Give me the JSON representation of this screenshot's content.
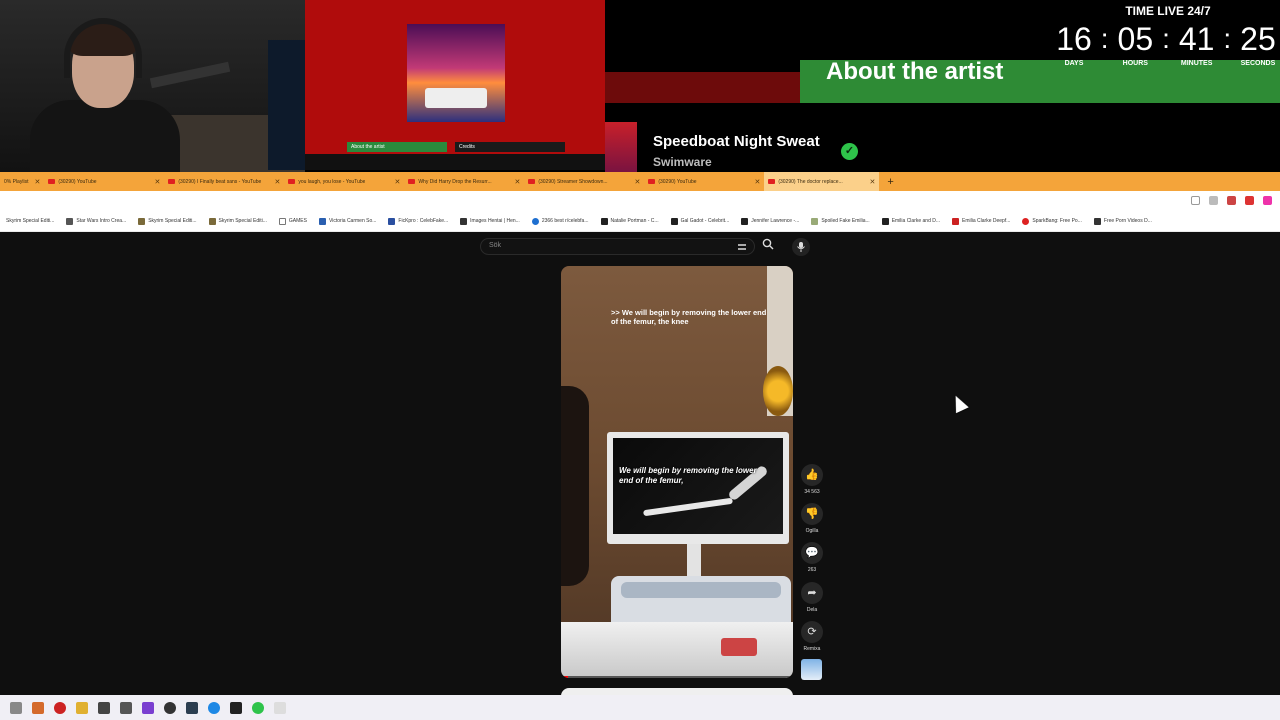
{
  "stream_overlay": {
    "time_live_label": "TIME LIVE 24/7",
    "timer": [
      {
        "value": "16",
        "caption": "DAYS"
      },
      {
        "value": "05",
        "caption": "HOURS"
      },
      {
        "value": "41",
        "caption": "MINUTES"
      },
      {
        "value": "25",
        "caption": "SECONDS"
      }
    ],
    "about_the_artist": "About the artist",
    "now_playing": {
      "title": "Speedboat Night Sweat",
      "artist": "Swimware"
    },
    "inner_screen": {
      "about_button": "About the artist",
      "credits_button": "Credits"
    }
  },
  "browser": {
    "tabs": [
      {
        "label": "0% Playlist",
        "icon": "youtube-icon"
      },
      {
        "label": "(30290) YouTube",
        "icon": "youtube-icon"
      },
      {
        "label": "(30290) I Finally beat sans - YouTube",
        "icon": "youtube-icon"
      },
      {
        "label": "you laugh, you lose - YouTube",
        "icon": "youtube-icon"
      },
      {
        "label": "Why Did Harry Drop the Resurr...",
        "icon": "youtube-icon"
      },
      {
        "label": "(30290) Streamer Showdown...",
        "icon": "youtube-icon"
      },
      {
        "label": "(30290) YouTube",
        "icon": "youtube-icon"
      },
      {
        "label": "(30290) The doctor replace...",
        "icon": "youtube-icon"
      }
    ],
    "bookmarks": [
      "Skyrim Special Editi...",
      "Star Wars Intro Crea...",
      "Skyrim Special Editi...",
      "Skyrim Special Editi...",
      "GAMES",
      "Victoria Carmen So...",
      "FicKpro : CelebFake...",
      "Images Hentai | Hen...",
      "2366 best r/celebfa...",
      "Natalie Portman - C...",
      "Gal Gadot - Celebrit...",
      "Jennifer Lawrence -...",
      "Spoiled Fake Emilia...",
      "Emilia Clarke and D...",
      "Emilia Clarke Deepf...",
      "SparkBang: Free Po...",
      "Free Porn Videos D..."
    ]
  },
  "youtube": {
    "search_placeholder": "Sök",
    "video": {
      "top_caption": ">> We will begin by removing the lower end of the femur, the knee",
      "screen_caption": "We will begin by removing the lower end of the femur,",
      "progress": 0.03
    },
    "actions": [
      {
        "icon": "thumbs-up-icon",
        "label": "34 563",
        "glyph": "👍"
      },
      {
        "icon": "thumbs-down-icon",
        "label": "Ogilla",
        "glyph": "👎"
      },
      {
        "icon": "comment-icon",
        "label": "263",
        "glyph": "💬"
      },
      {
        "icon": "share-icon",
        "label": "Dela",
        "glyph": "➦"
      },
      {
        "icon": "remix-icon",
        "label": "Remixa",
        "glyph": "⟳"
      }
    ]
  }
}
